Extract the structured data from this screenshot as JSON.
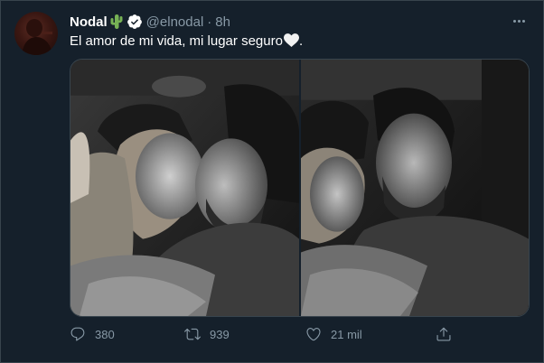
{
  "tweet": {
    "author_name": "Nodal",
    "author_emoji": "cactus-emoji",
    "verified": true,
    "handle": "@elnodal",
    "separator": "·",
    "time": "8h",
    "text": "El amor de mi vida, mi lugar seguro",
    "text_emoji": "white-heart-emoji",
    "media": [
      {
        "icon": "photo-couple-1"
      },
      {
        "icon": "photo-couple-2"
      }
    ]
  },
  "actions": {
    "reply_count": "380",
    "retweet_count": "939",
    "like_count": "21 mil"
  },
  "colors": {
    "background": "#15202b",
    "border": "#38444d",
    "secondary_text": "#8899a6",
    "primary_text": "#ffffff",
    "verified_badge": "#ffffff",
    "cactus": "#77b255"
  }
}
